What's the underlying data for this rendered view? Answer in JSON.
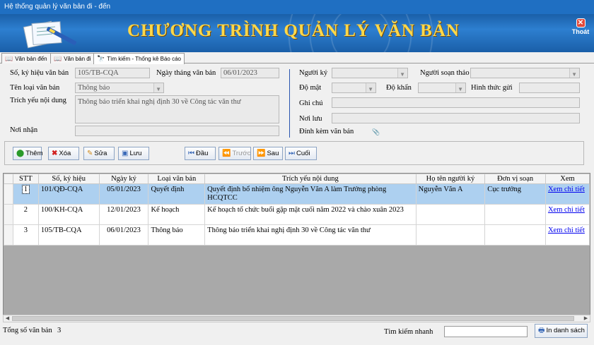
{
  "window": {
    "title": "Hệ thống quản lý văn bản đi - đến"
  },
  "banner": {
    "title": "CHƯƠNG TRÌNH QUẢN LÝ VĂN BẢN",
    "exit_label": "Thoát",
    "exit_glyph": "✕"
  },
  "tabs": [
    {
      "label": "Văn bản đến",
      "icon": "book-icon"
    },
    {
      "label": "Văn bản đi",
      "icon": "book-icon"
    },
    {
      "label": "Tìm kiếm - Thống kê Báo cáo",
      "icon": "binoculars-icon"
    }
  ],
  "form": {
    "so_ky_hieu": {
      "label": "Số, ký hiệu văn bản",
      "value": "105/TB-CQA"
    },
    "ngay_thang": {
      "label": "Ngày tháng văn bản",
      "value": "06/01/2023"
    },
    "ten_loai": {
      "label": "Tên loại văn bản",
      "value": "Thông báo"
    },
    "trich_yeu": {
      "label": "Trích yếu nội dung",
      "value": "Thông báo triển khai nghị định 30 về Công tác văn thư"
    },
    "noi_nhan": {
      "label": "Nơi nhận",
      "value": ""
    },
    "nguoi_ky": {
      "label": "Người ký",
      "value": ""
    },
    "nguoi_soan": {
      "label": "Người soạn thảo",
      "value": ""
    },
    "do_mat": {
      "label": "Độ mật",
      "value": ""
    },
    "do_khan": {
      "label": "Độ khẩn",
      "value": ""
    },
    "hinh_thuc_gui": {
      "label": "Hình thức gửi",
      "value": ""
    },
    "ghi_chu": {
      "label": "Ghi chú",
      "value": ""
    },
    "noi_luu": {
      "label": "Nơi lưu",
      "value": ""
    },
    "dinh_kem": {
      "label": "Đính kèm văn bản"
    }
  },
  "toolbar": {
    "add": "Thêm",
    "delete": "Xóa",
    "edit": "Sửa",
    "save": "Lưu",
    "first": "Đầu",
    "prev": "Trước",
    "next": "Sau",
    "last": "Cuối"
  },
  "grid": {
    "columns": [
      "STT",
      "Số, ký hiệu",
      "Ngày ký",
      "Loại văn bản",
      "Trích yếu nội dung",
      "Họ tên người ký",
      "Đơn vị soạn",
      "Xem"
    ],
    "rows": [
      {
        "stt": "1",
        "so": "101/QĐ-CQA",
        "ngay": "05/01/2023",
        "loai": "Quyết định",
        "trich_yeu": "Quyết định bổ nhiệm ông Nguyễn Văn A làm Trưởng phòng HCQTCC",
        "nguoi_ky": "Nguyễn Văn A",
        "don_vi": "Cục trưởng",
        "xem": "Xem chi tiết"
      },
      {
        "stt": "2",
        "so": "100/KH-CQA",
        "ngay": "12/01/2023",
        "loai": "Kế hoạch",
        "trich_yeu": "Kế hoạch tổ chức buổi gặp mặt cuối năm 2022 và chào xuân 2023",
        "nguoi_ky": "",
        "don_vi": "",
        "xem": "Xem chi tiết"
      },
      {
        "stt": "3",
        "so": "105/TB-CQA",
        "ngay": "06/01/2023",
        "loai": "Thông báo",
        "trich_yeu": "Thông báo triển khai nghị định 30 về Công tác văn thư",
        "nguoi_ky": "",
        "don_vi": "",
        "xem": "Xem chi tiết"
      }
    ]
  },
  "footer": {
    "total_label": "Tổng số văn bản",
    "total_value": "3",
    "search_label": "Tìm kiếm nhanh",
    "search_value": "",
    "print_label": "In danh sách"
  },
  "colors": {
    "titlebar": "#1f6fc2",
    "banner_text": "#ffd84a",
    "selected_row": "#add0f0",
    "link": "#0000ee"
  }
}
